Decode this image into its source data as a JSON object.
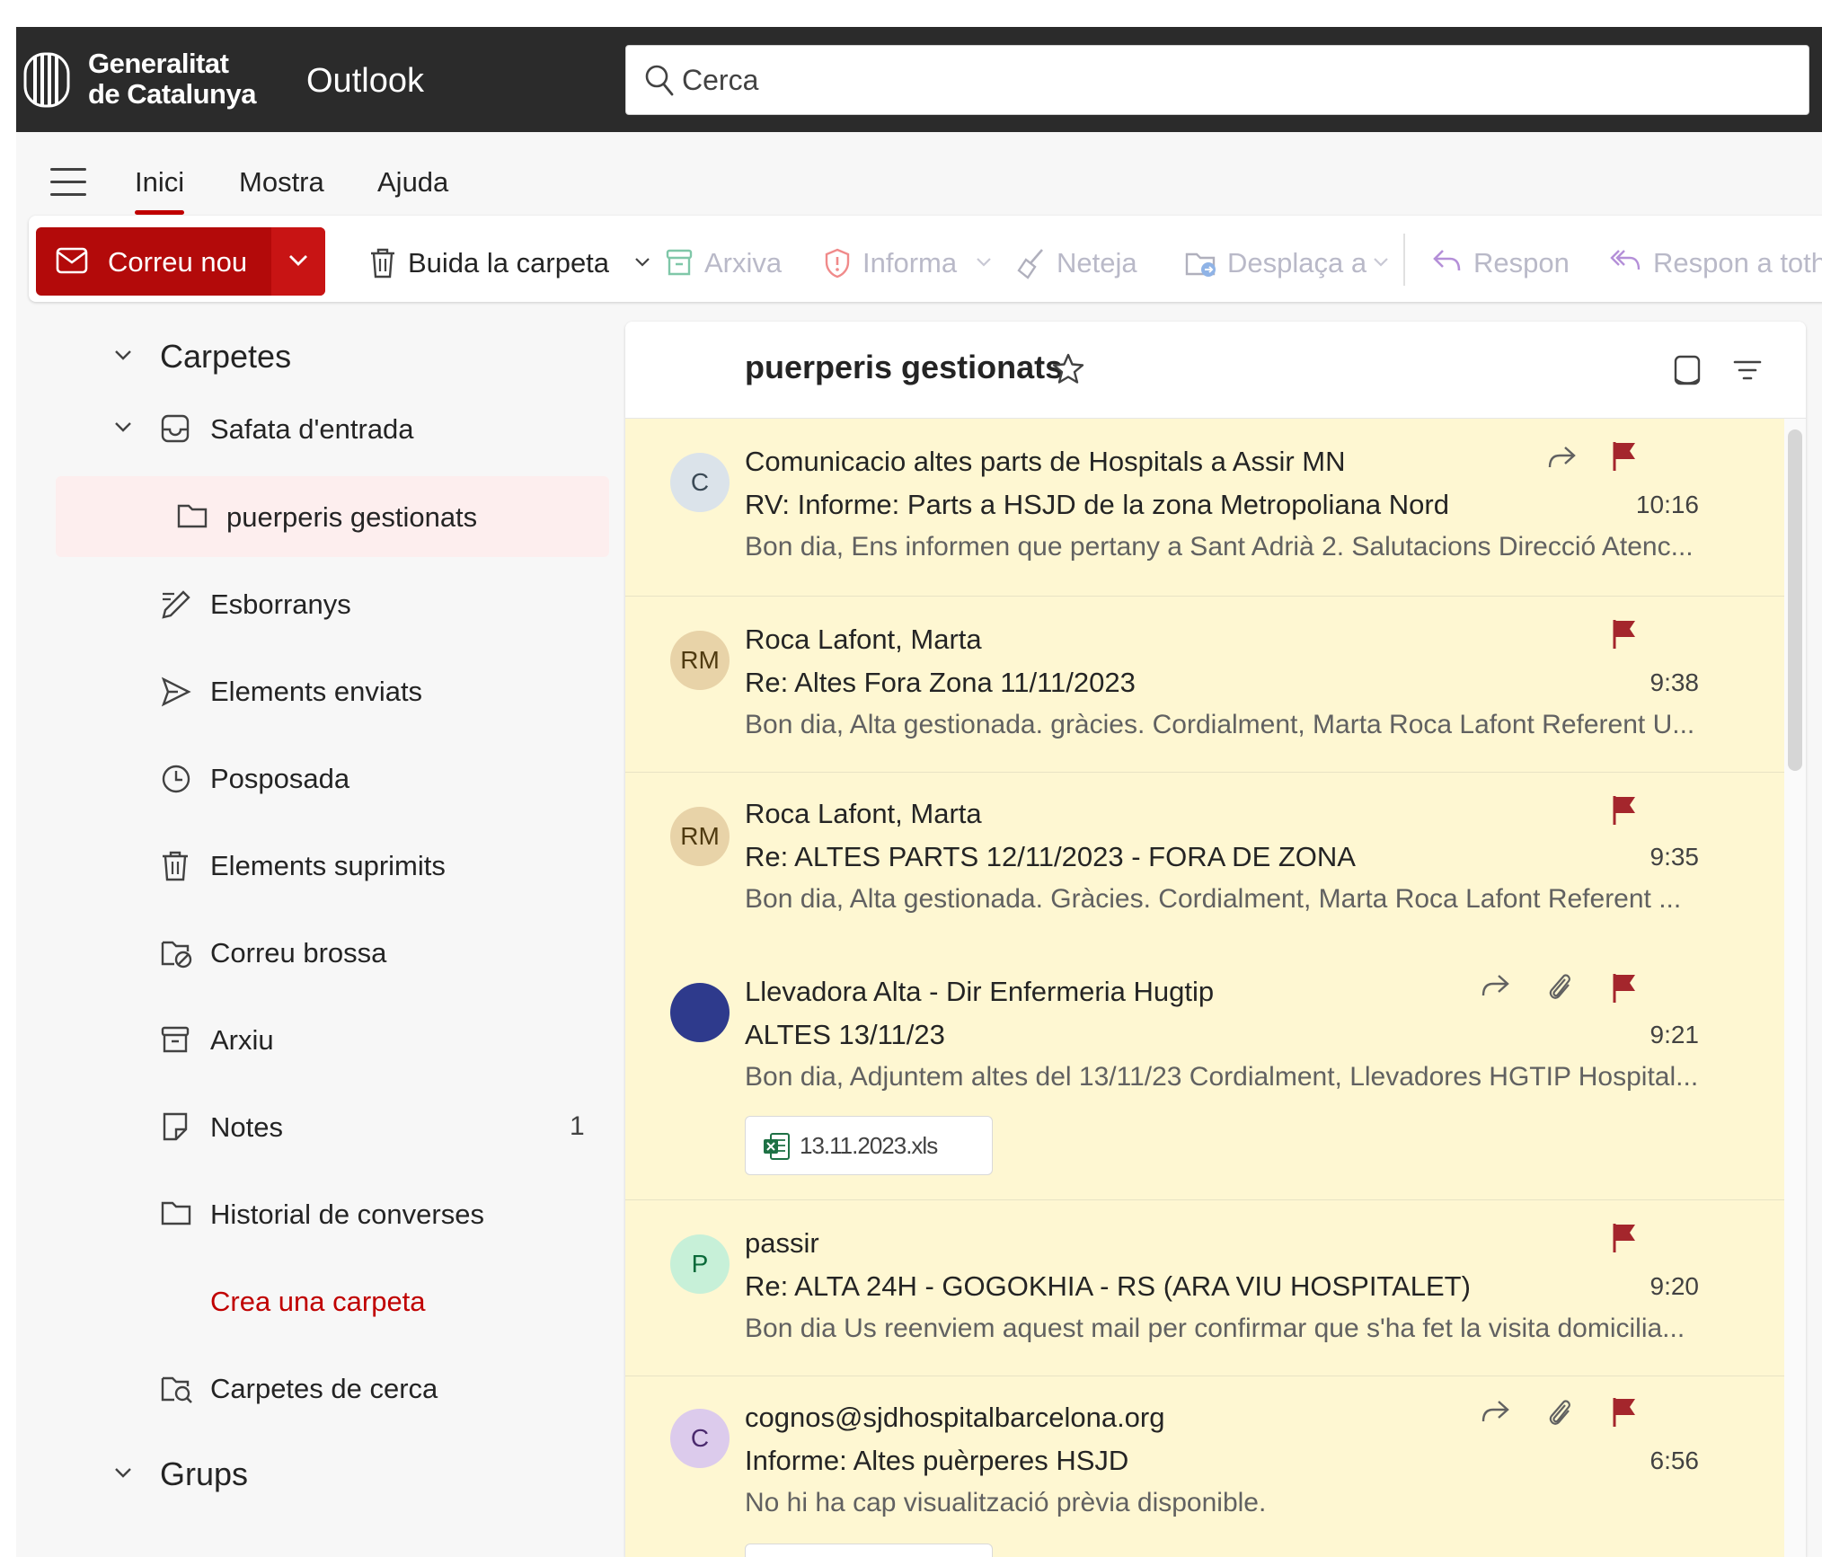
{
  "brand": {
    "line1": "Generalitat",
    "line2": "de Catalunya"
  },
  "app": {
    "name": "Outlook"
  },
  "search": {
    "placeholder": "Cerca"
  },
  "tabs": [
    {
      "label": "Inici",
      "active": true
    },
    {
      "label": "Mostra"
    },
    {
      "label": "Ajuda"
    }
  ],
  "ribbon": {
    "new_mail": "Correu nou",
    "empty_folder": "Buida la carpeta",
    "archive": "Arxiva",
    "report": "Informa",
    "sweep": "Neteja",
    "move_to": "Desplaça a",
    "reply": "Respon",
    "reply_all": "Respon a totho"
  },
  "folders": {
    "section": "Carpetes",
    "items": [
      {
        "label": "Safata d'entrada"
      },
      {
        "label": "puerperis gestionats",
        "selected": true
      },
      {
        "label": "Esborranys"
      },
      {
        "label": "Elements enviats"
      },
      {
        "label": "Posposada"
      },
      {
        "label": "Elements suprimits"
      },
      {
        "label": "Correu brossa"
      },
      {
        "label": "Arxiu"
      },
      {
        "label": "Notes",
        "count": "1"
      },
      {
        "label": "Historial de converses"
      },
      {
        "label": "Crea una carpeta"
      },
      {
        "label": "Carpetes de cerca"
      }
    ],
    "groups": "Grups"
  },
  "list": {
    "title": "puerperis gestionats",
    "messages": [
      {
        "initials": "C",
        "sender": "Comunicacio altes parts de Hospitals a Assir MN",
        "subject": "RV: Informe: Parts a HSJD de la zona Metropoliana Nord",
        "time": "10:16",
        "preview": "Bon dia, Ens informen que pertany a Sant Adrià 2. Salutacions Direcció Atenc...",
        "avatar_bg": "#dbe3ea",
        "avatar_fg": "#3b4a56"
      },
      {
        "initials": "RM",
        "sender": "Roca Lafont, Marta",
        "subject": "Re: Altes Fora Zona 11/11/2023",
        "time": "9:38",
        "preview": "Bon dia, Alta gestionada. gràcies. Cordialment, Marta Roca Lafont Referent U...",
        "avatar_bg": "#e8d3a8",
        "avatar_fg": "#4f3a10"
      },
      {
        "initials": "RM",
        "sender": "Roca Lafont, Marta",
        "subject": "Re: ALTES PARTS 12/11/2023 - FORA DE ZONA",
        "time": "9:35",
        "preview": "Bon dia, Alta gestionada. Gràcies. Cordialment, Marta Roca Lafont Referent ...",
        "avatar_bg": "#e8d3a8",
        "avatar_fg": "#4f3a10"
      },
      {
        "initials": "",
        "sender": "Llevadora Alta - Dir Enfermeria Hugtip",
        "subject": "ALTES 13/11/23",
        "time": "9:21",
        "preview": "Bon dia, Adjuntem altes del 13/11/23 Cordialment, Llevadores HGTIP Hospital...",
        "attachment": "13.11.2023.xls",
        "avatar_bg": "#2e3a8c",
        "avatar_fg": "#ffffff"
      },
      {
        "initials": "P",
        "sender": "passir",
        "subject": "Re: ALTA 24H - GOGOKHIA - RS (ARA VIU HOSPITALET)",
        "time": "9:20",
        "preview": "Bon dia Us reenviem aquest mail per confirmar que s'ha fet la visita domicilia...",
        "avatar_bg": "#c7f0d8",
        "avatar_fg": "#0b6a3a"
      },
      {
        "initials": "C",
        "sender": "cognos@sjdhospitalbarcelona.org",
        "subject": "Informe: Altes puèrperes HSJD",
        "time": "6:56",
        "preview": "No hi ha cap visualització prèvia disponible.",
        "avatar_bg": "#dccbec",
        "avatar_fg": "#4b2a6e"
      }
    ]
  },
  "colors": {
    "accent": "#b30a0a",
    "flag": "#a4262c",
    "unread_bg": "#fef7d2",
    "topbar": "#2b2b2b"
  }
}
